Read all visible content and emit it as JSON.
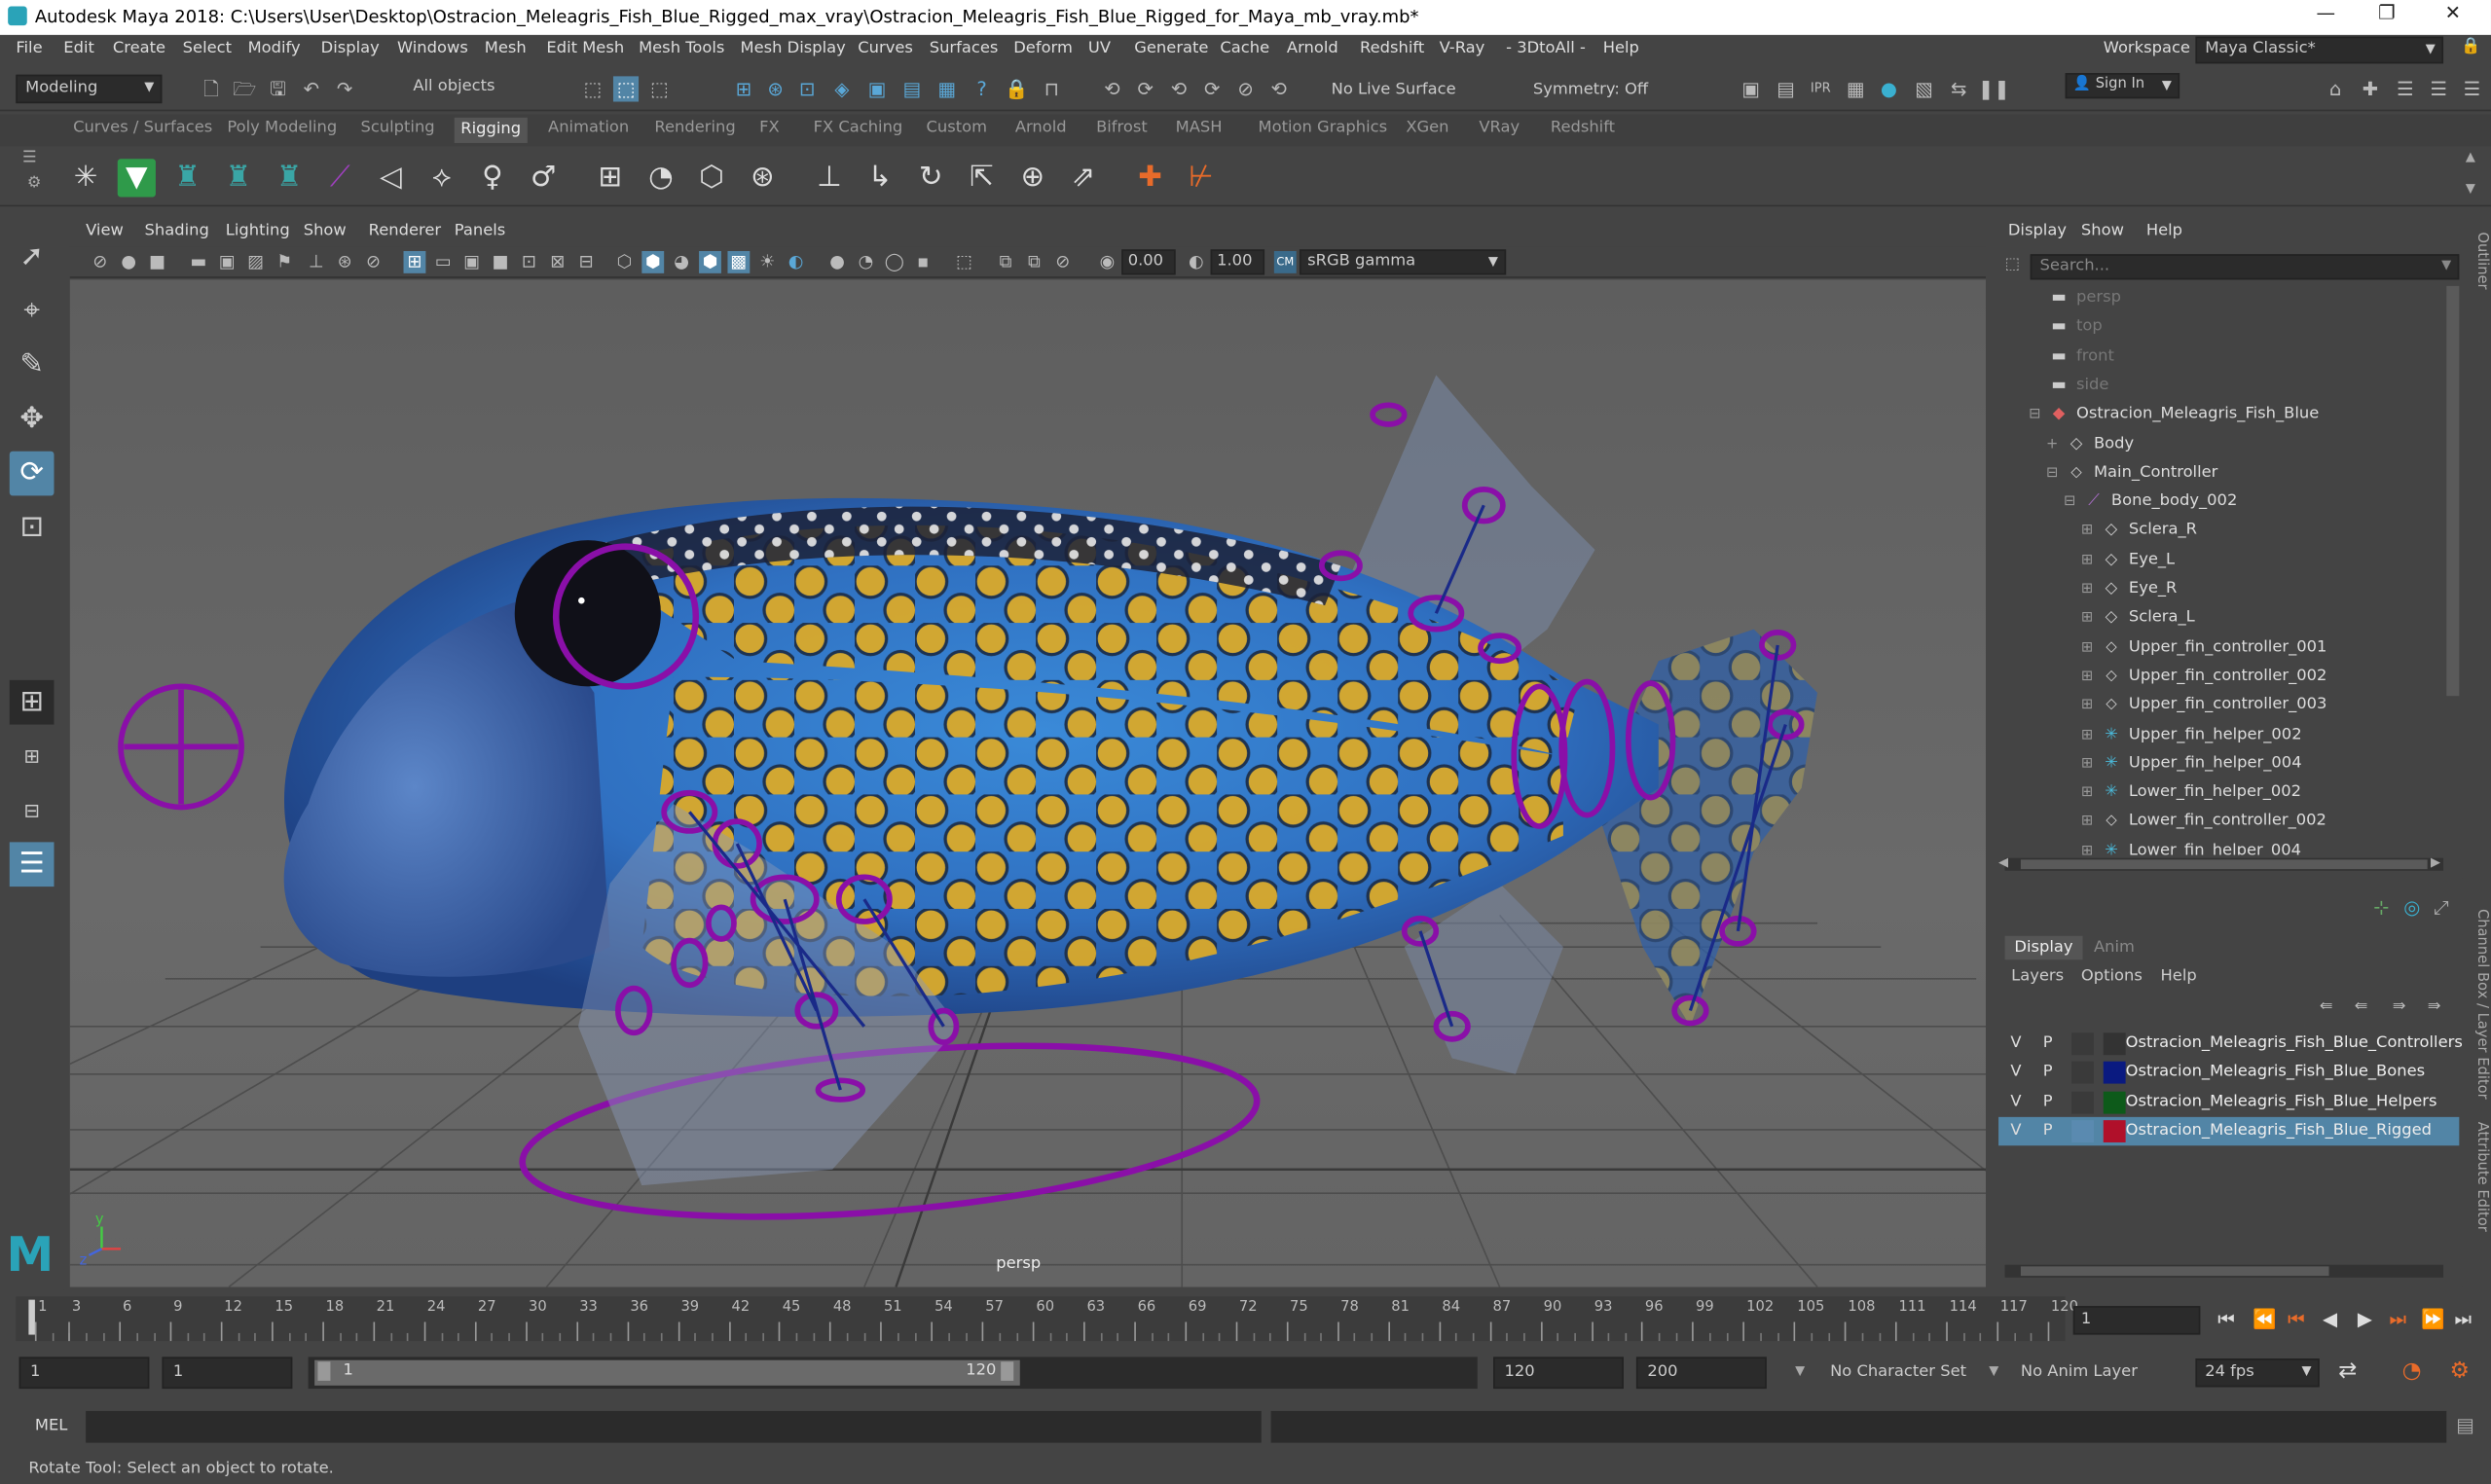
{
  "title": "Autodesk Maya 2018: C:\\Users\\User\\Desktop\\Ostracion_Meleagris_Fish_Blue_Rigged_max_vray\\Ostracion_Meleagris_Fish_Blue_Rigged_for_Maya_mb_vray.mb*",
  "window_controls": {
    "minimize": "—",
    "maximize": "❐",
    "close": "✕"
  },
  "menu": [
    "File",
    "Edit",
    "Create",
    "Select",
    "Modify",
    "Display",
    "Windows",
    "Mesh",
    "Edit Mesh",
    "Mesh Tools",
    "Mesh Display",
    "Curves",
    "Surfaces",
    "Deform",
    "UV",
    "Generate",
    "Cache",
    "Arnold",
    "Redshift",
    "V-Ray",
    "- 3DtoAll -",
    "Help"
  ],
  "workspace": {
    "label": "Workspace :",
    "value": "Maya Classic*"
  },
  "status": {
    "mode": "Modeling",
    "select_mask": "All objects",
    "live_surface": "No Live Surface",
    "symmetry": "Symmetry: Off",
    "sign_in": "Sign In"
  },
  "shelf_tabs": [
    "Curves / Surfaces",
    "Poly Modeling",
    "Sculpting",
    "Rigging",
    "Animation",
    "Rendering",
    "FX",
    "FX Caching",
    "Custom",
    "Arnold",
    "Bifrost",
    "MASH",
    "Motion Graphics",
    "XGen",
    "VRay",
    "Redshift"
  ],
  "active_shelf": "Rigging",
  "viewport": {
    "menu": [
      "View",
      "Shading",
      "Lighting",
      "Show",
      "Renderer",
      "Panels"
    ],
    "exposure": "0.00",
    "gamma": "1.00",
    "color_space": "sRGB gamma",
    "camera_label": "persp"
  },
  "outliner": {
    "menu": [
      "Display",
      "Show",
      "Help"
    ],
    "search_placeholder": "Search...",
    "items": [
      {
        "label": "persp",
        "icon": "camera-icon",
        "dim": true
      },
      {
        "label": "top",
        "icon": "camera-icon",
        "dim": true
      },
      {
        "label": "front",
        "icon": "camera-icon",
        "dim": true
      },
      {
        "label": "side",
        "icon": "camera-icon",
        "dim": true
      },
      {
        "label": "Ostracion_Meleagris_Fish_Blue",
        "icon": "mesh-icon",
        "dim": false
      },
      {
        "label": "Body",
        "icon": "group-icon",
        "dim": false
      },
      {
        "label": "Main_Controller",
        "icon": "curve-icon",
        "dim": false
      },
      {
        "label": "Bone_body_002",
        "icon": "joint-icon",
        "dim": false
      },
      {
        "label": "Sclera_R",
        "icon": "group-icon",
        "dim": false
      },
      {
        "label": "Eye_L",
        "icon": "group-icon",
        "dim": false
      },
      {
        "label": "Eye_R",
        "icon": "group-icon",
        "dim": false
      },
      {
        "label": "Sclera_L",
        "icon": "group-icon",
        "dim": false
      },
      {
        "label": "Upper_fin_controller_001",
        "icon": "curve-icon",
        "dim": false
      },
      {
        "label": "Upper_fin_controller_002",
        "icon": "curve-icon",
        "dim": false
      },
      {
        "label": "Upper_fin_controller_003",
        "icon": "curve-icon",
        "dim": false
      },
      {
        "label": "Upper_fin_helper_002",
        "icon": "locator-icon",
        "dim": false
      },
      {
        "label": "Upper_fin_helper_004",
        "icon": "locator-icon",
        "dim": false
      },
      {
        "label": "Lower_fin_helper_002",
        "icon": "locator-icon",
        "dim": false
      },
      {
        "label": "Lower_fin_controller_002",
        "icon": "curve-icon",
        "dim": false
      },
      {
        "label": "Lower_fin_helper_004",
        "icon": "locator-icon",
        "dim": false
      }
    ]
  },
  "channel_box": {
    "tabs": [
      "Display",
      "Anim"
    ],
    "active_tab": "Display",
    "menu": [
      "Layers",
      "Options",
      "Help"
    ],
    "layers": [
      {
        "v": "V",
        "p": "P",
        "color": "#333333",
        "name": "Ostracion_Meleagris_Fish_Blue_Controllers",
        "selected": false
      },
      {
        "v": "V",
        "p": "P",
        "color": "#0a1a80",
        "name": "Ostracion_Meleagris_Fish_Blue_Bones",
        "selected": false
      },
      {
        "v": "V",
        "p": "P",
        "color": "#0d5a1a",
        "name": "Ostracion_Meleagris_Fish_Blue_Helpers",
        "selected": false
      },
      {
        "v": "V",
        "p": "P",
        "color": "#b0102a",
        "name": "Ostracion_Meleagris_Fish_Blue_Rigged",
        "selected": true
      }
    ]
  },
  "side_tabs": [
    "Outliner",
    "Channel Box / Layer Editor",
    "Attribute Editor"
  ],
  "timeline": {
    "ticks": [
      "1",
      "3",
      "6",
      "9",
      "12",
      "15",
      "18",
      "21",
      "24",
      "27",
      "30",
      "33",
      "36",
      "39",
      "42",
      "45",
      "48",
      "51",
      "54",
      "57",
      "60",
      "63",
      "66",
      "69",
      "72",
      "75",
      "78",
      "81",
      "84",
      "87",
      "90",
      "93",
      "96",
      "99",
      "102",
      "105",
      "108",
      "111",
      "114",
      "117",
      "120"
    ],
    "current_frame": "1"
  },
  "range": {
    "start": "1",
    "playback_start": "1",
    "slider_start": "1",
    "slider_end": "120",
    "playback_end": "120",
    "end": "200",
    "character_set": "No Character Set",
    "anim_layer": "No Anim Layer",
    "fps": "24 fps"
  },
  "mel": {
    "label": "MEL"
  },
  "help_line": "Rotate Tool: Select an object to rotate.",
  "accent": "#5285a6",
  "rig_color": "#8a0fa8"
}
